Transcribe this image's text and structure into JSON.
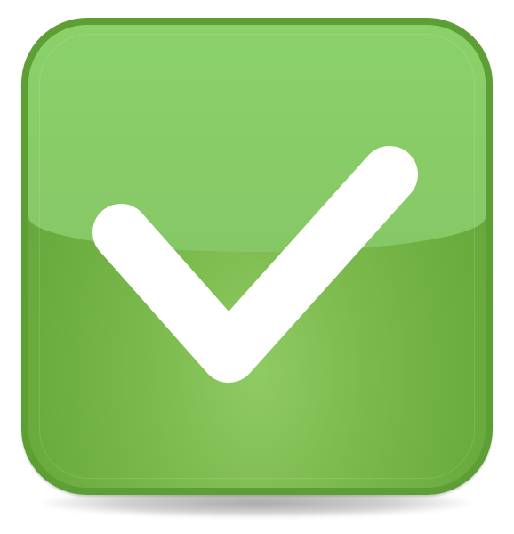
{
  "icon": {
    "name": "check-icon",
    "shape": "rounded-square-button",
    "colors": {
      "button_fill": "#86c866",
      "button_border": "#5e9f35",
      "icon": "#ffffff",
      "background": "#ffffff"
    }
  }
}
